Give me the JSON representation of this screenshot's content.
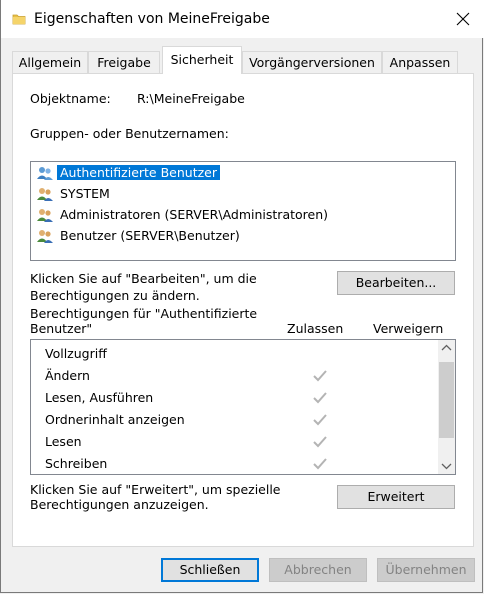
{
  "window": {
    "title": "Eigenschaften von MeineFreigabe"
  },
  "tabs": [
    {
      "label": "Allgemein",
      "active": false
    },
    {
      "label": "Freigabe",
      "active": false
    },
    {
      "label": "Sicherheit",
      "active": true
    },
    {
      "label": "Vorgängerversionen",
      "active": false
    },
    {
      "label": "Anpassen",
      "active": false
    }
  ],
  "object": {
    "label": "Objektname:",
    "value": "R:\\MeineFreigabe"
  },
  "groups": {
    "label": "Gruppen- oder Benutzernamen:",
    "items": [
      {
        "name": "Authentifizierte Benutzer",
        "selected": true
      },
      {
        "name": "SYSTEM",
        "selected": false
      },
      {
        "name": "Administratoren (SERVER\\Administratoren)",
        "selected": false
      },
      {
        "name": "Benutzer (SERVER\\Benutzer)",
        "selected": false
      }
    ]
  },
  "edit": {
    "hint_line1": "Klicken Sie auf \"Bearbeiten\", um die",
    "hint_line2": "Berechtigungen zu ändern.",
    "button": "Bearbeiten..."
  },
  "permissions": {
    "header_line1": "Berechtigungen für \"Authentifizierte",
    "header_line2": "Benutzer\"",
    "col_allow": "Zulassen",
    "col_deny": "Verweigern",
    "rows": [
      {
        "name": "Vollzugriff",
        "allow": false,
        "deny": false
      },
      {
        "name": "Ändern",
        "allow": true,
        "deny": false
      },
      {
        "name": "Lesen, Ausführen",
        "allow": true,
        "deny": false
      },
      {
        "name": "Ordnerinhalt anzeigen",
        "allow": true,
        "deny": false
      },
      {
        "name": "Lesen",
        "allow": true,
        "deny": false
      },
      {
        "name": "Schreiben",
        "allow": true,
        "deny": false
      }
    ]
  },
  "advanced": {
    "hint_line1": "Klicken Sie auf \"Erweitert\", um spezielle",
    "hint_line2": "Berechtigungen anzuzeigen.",
    "button": "Erweitert"
  },
  "footer": {
    "close": "Schließen",
    "cancel": "Abbrechen",
    "apply": "Übernehmen"
  },
  "colors": {
    "selection": "#0078d7",
    "check": "#b4b4b4"
  }
}
